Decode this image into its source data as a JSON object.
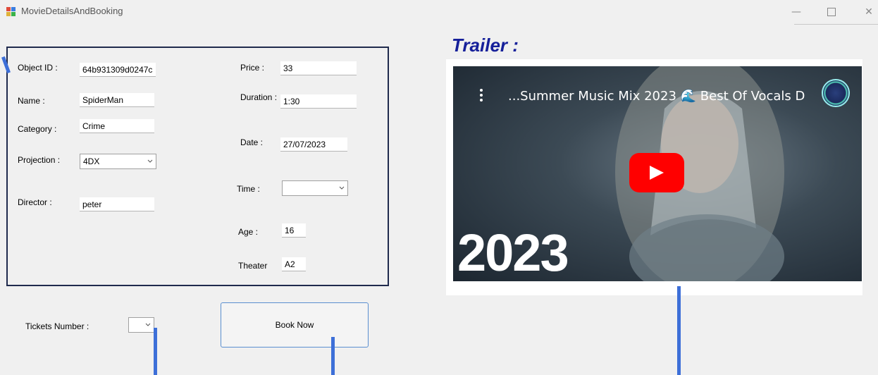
{
  "window": {
    "title": "MovieDetailsAndBooking",
    "controls": {
      "minimize": "—",
      "close": "✕"
    }
  },
  "details": {
    "object_id_label": "Object ID :",
    "object_id_value": "64b931309d0247c",
    "name_label": "Name :",
    "name_value": "SpiderMan",
    "category_label": "Category :",
    "category_value": "Crime",
    "projection_label": "Projection :",
    "projection_value": "4DX",
    "director_label": "Director :",
    "director_value": "peter",
    "price_label": "Price :",
    "price_value": "33",
    "duration_label": "Duration :",
    "duration_value": "1:30",
    "date_label": "Date :",
    "date_value": "27/07/2023",
    "time_label": "Time :",
    "time_value": "",
    "age_label": "Age :",
    "age_value": "16",
    "theater_label": "Theater",
    "theater_value": "A2"
  },
  "booking": {
    "tickets_label": "Tickets Number :",
    "tickets_value": "",
    "book_button": "Book Now"
  },
  "trailer": {
    "heading": "Trailer :",
    "video_title": "...Summer Music Mix 2023 🌊 Best Of Vocals D",
    "overlay_year": "2023"
  },
  "colors": {
    "panel_border": "#1f2a4d",
    "trailer_heading": "#16209a",
    "annotation_line": "#3d6fd8",
    "play_button": "#ff0000"
  }
}
